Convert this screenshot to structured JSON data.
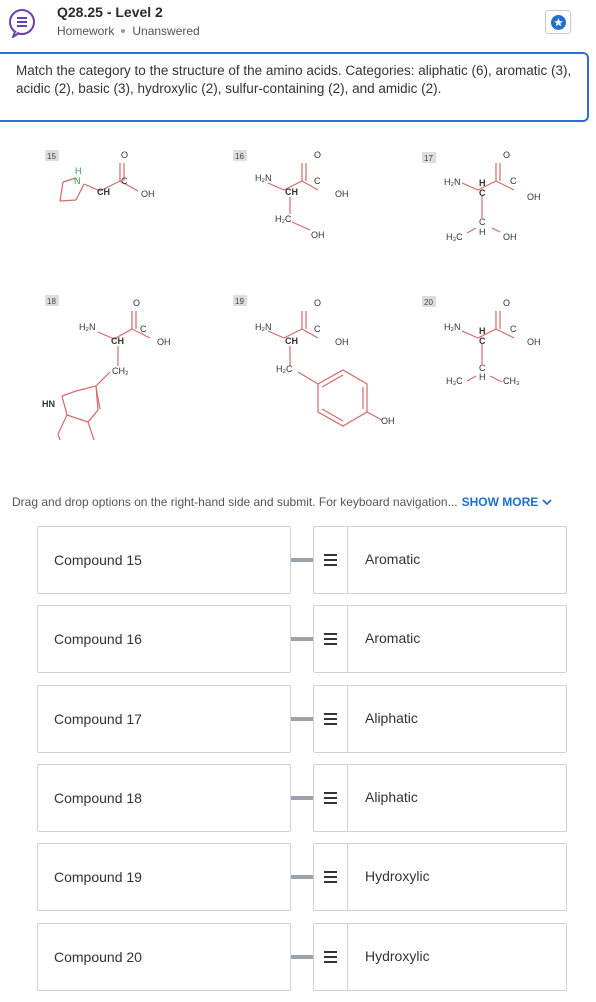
{
  "header": {
    "title": "Q28.25 - Level 2",
    "category": "Homework",
    "status": "Unanswered",
    "icon": "question-bubble-icon",
    "bookmark_icon": "star-icon"
  },
  "prompt": {
    "text": "Match the category to the structure of the amino acids. Categories: aliphatic (6), aromatic (3), acidic (2), basic (3), hydroxylic (2), sulfur-containing (2), and amidic (2)."
  },
  "structures": {
    "labels": [
      "15",
      "16",
      "17",
      "18",
      "19",
      "20"
    ],
    "atoms": {
      "h2n": "H₂N",
      "ch": "CH",
      "c": "C",
      "o": "O",
      "oh": "OH",
      "h": "H",
      "n": "N",
      "hn": "HN",
      "h2c": "H₂C",
      "h3c": "H₃C",
      "ch2": "CH₂",
      "ch3": "CH₃"
    }
  },
  "instructions": {
    "text": "Drag and drop options on the right-hand side and submit. For keyboard navigation...",
    "show_more": "SHOW MORE"
  },
  "matches": [
    {
      "compound": "Compound 15",
      "answer": "Aromatic"
    },
    {
      "compound": "Compound 16",
      "answer": "Aromatic"
    },
    {
      "compound": "Compound 17",
      "answer": "Aliphatic"
    },
    {
      "compound": "Compound 18",
      "answer": "Aliphatic"
    },
    {
      "compound": "Compound 19",
      "answer": "Hydroxylic"
    },
    {
      "compound": "Compound 20",
      "answer": "Hydroxylic"
    }
  ],
  "colors": {
    "accent": "#2f6bdb",
    "link": "#1e6fd0",
    "ring": "#e58a8a",
    "bond": "#d46a6a",
    "nitrogen": "#2a9d3c"
  }
}
